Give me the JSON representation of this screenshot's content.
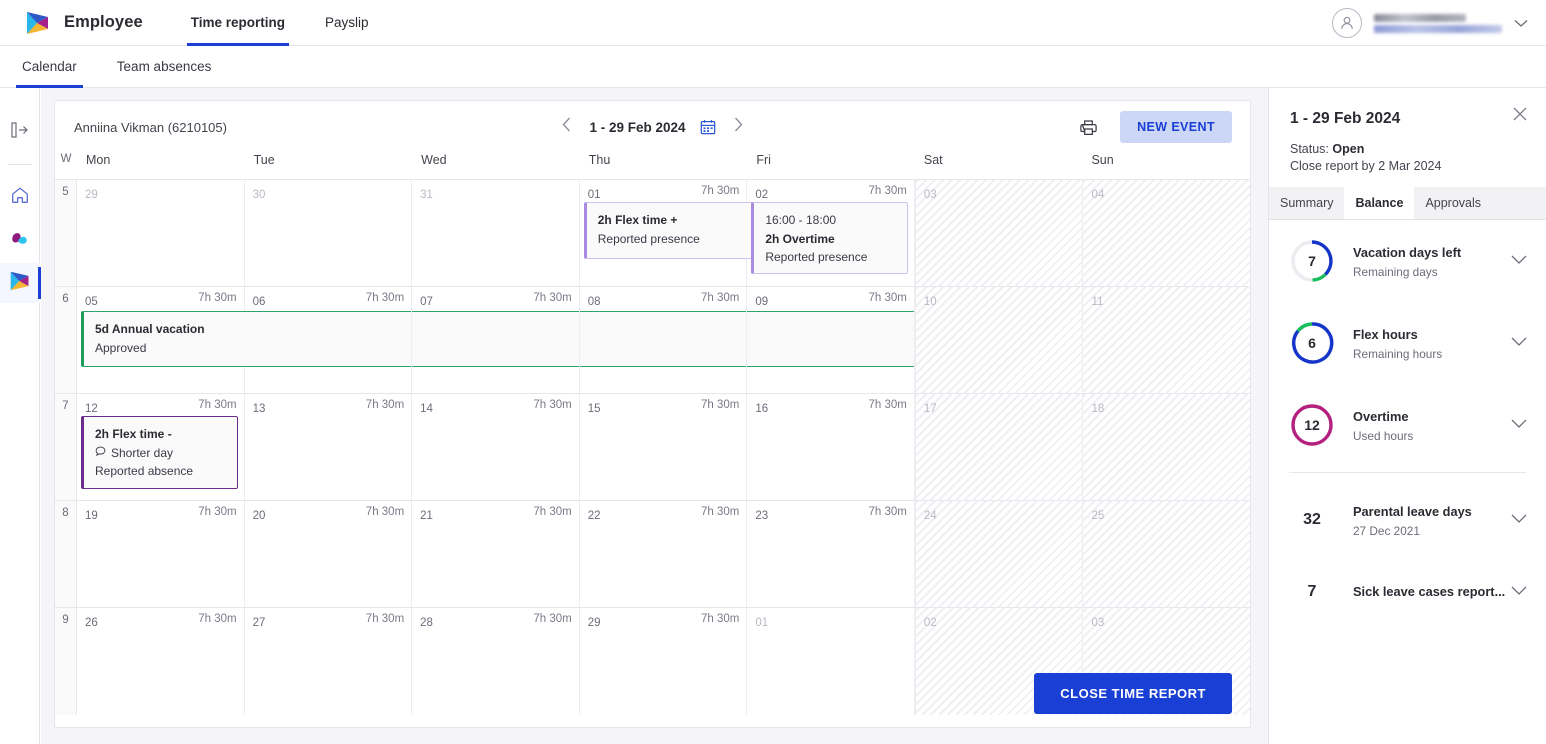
{
  "brand": {
    "name": "Employee",
    "logo_icon": "play-logo-icon"
  },
  "topnav": [
    {
      "label": "Time reporting",
      "active": true
    },
    {
      "label": "Payslip",
      "active": false
    }
  ],
  "subnav": [
    {
      "label": "Calendar",
      "active": true
    },
    {
      "label": "Team absences",
      "active": false
    }
  ],
  "user": {
    "avatar_icon": "person-avatar-icon",
    "caret_icon": "chevron-down-icon"
  },
  "rail": [
    {
      "icon": "panel-expand-icon",
      "active": false
    },
    {
      "icon": "home-icon",
      "active": false
    },
    {
      "icon": "cloud-leaf-icon",
      "active": false
    },
    {
      "icon": "play-logo-icon",
      "active": true
    }
  ],
  "calendar": {
    "employee": "Anniina Vikman (6210105)",
    "period": "1 - 29 Feb 2024",
    "prev_icon": "chevron-left-icon",
    "next_icon": "chevron-right-icon",
    "datepicker_icon": "calendar-icon",
    "print_icon": "printer-icon",
    "new_event_label": "NEW EVENT",
    "close_report_label": "CLOSE TIME REPORT",
    "week_col_header": "W",
    "day_headers": [
      "Mon",
      "Tue",
      "Wed",
      "Thu",
      "Fri",
      "Sat",
      "Sun"
    ],
    "default_hours": "7h 30m",
    "weeks": [
      {
        "week": "5",
        "days": [
          {
            "num": "29",
            "hours": "",
            "muted": true
          },
          {
            "num": "30",
            "hours": "",
            "muted": true
          },
          {
            "num": "31",
            "hours": "",
            "muted": true
          },
          {
            "num": "01",
            "hours": "7h 30m",
            "muted": false
          },
          {
            "num": "02",
            "hours": "7h 30m",
            "muted": false
          },
          {
            "num": "03",
            "hours": "",
            "muted": true,
            "weekend": true
          },
          {
            "num": "04",
            "hours": "",
            "muted": true,
            "weekend": true
          }
        ]
      },
      {
        "week": "6",
        "days": [
          {
            "num": "05",
            "hours": "7h 30m",
            "muted": false
          },
          {
            "num": "06",
            "hours": "7h 30m",
            "muted": false
          },
          {
            "num": "07",
            "hours": "7h 30m",
            "muted": false
          },
          {
            "num": "08",
            "hours": "7h 30m",
            "muted": false
          },
          {
            "num": "09",
            "hours": "7h 30m",
            "muted": false
          },
          {
            "num": "10",
            "hours": "",
            "muted": true,
            "weekend": true
          },
          {
            "num": "11",
            "hours": "",
            "muted": true,
            "weekend": true
          }
        ]
      },
      {
        "week": "7",
        "days": [
          {
            "num": "12",
            "hours": "7h 30m",
            "muted": false
          },
          {
            "num": "13",
            "hours": "7h 30m",
            "muted": false
          },
          {
            "num": "14",
            "hours": "7h 30m",
            "muted": false
          },
          {
            "num": "15",
            "hours": "7h 30m",
            "muted": false
          },
          {
            "num": "16",
            "hours": "7h 30m",
            "muted": false
          },
          {
            "num": "17",
            "hours": "",
            "muted": true,
            "weekend": true
          },
          {
            "num": "18",
            "hours": "",
            "muted": true,
            "weekend": true
          }
        ]
      },
      {
        "week": "8",
        "days": [
          {
            "num": "19",
            "hours": "7h 30m",
            "muted": false
          },
          {
            "num": "20",
            "hours": "7h 30m",
            "muted": false
          },
          {
            "num": "21",
            "hours": "7h 30m",
            "muted": false
          },
          {
            "num": "22",
            "hours": "7h 30m",
            "muted": false
          },
          {
            "num": "23",
            "hours": "7h 30m",
            "muted": false
          },
          {
            "num": "24",
            "hours": "",
            "muted": true,
            "weekend": true
          },
          {
            "num": "25",
            "hours": "",
            "muted": true,
            "weekend": true
          }
        ]
      },
      {
        "week": "9",
        "days": [
          {
            "num": "26",
            "hours": "7h 30m",
            "muted": false
          },
          {
            "num": "27",
            "hours": "7h 30m",
            "muted": false
          },
          {
            "num": "28",
            "hours": "7h 30m",
            "muted": false
          },
          {
            "num": "29",
            "hours": "7h 30m",
            "muted": false
          },
          {
            "num": "01",
            "hours": "",
            "muted": true
          },
          {
            "num": "02",
            "hours": "",
            "muted": true,
            "weekend": true
          },
          {
            "num": "03",
            "hours": "",
            "muted": true,
            "weekend": true
          }
        ]
      }
    ],
    "events": {
      "flex_plus": {
        "title": "2h Flex time +",
        "status": "Reported presence"
      },
      "overtime": {
        "time": "16:00 - 18:00",
        "title": "2h Overtime",
        "status": "Reported presence"
      },
      "vacation": {
        "title": "5d Annual vacation",
        "status": "Approved"
      },
      "flex_minus": {
        "title": "2h Flex time -",
        "note": "Shorter day",
        "note_icon": "comment-icon",
        "status": "Reported absence"
      }
    }
  },
  "panel": {
    "title": "1 - 29 Feb 2024",
    "close_icon": "close-icon",
    "status_label": "Status:",
    "status_value": "Open",
    "due": "Close report by 2 Mar 2024",
    "tabs": [
      {
        "label": "Summary",
        "active": false
      },
      {
        "label": "Balance",
        "active": true
      },
      {
        "label": "Approvals",
        "active": false
      }
    ],
    "balances": [
      {
        "value": "7",
        "title": "Vacation days left",
        "sub": "Remaining days",
        "ring": true,
        "chevron_icon": "chevron-down-icon"
      },
      {
        "value": "6",
        "title": "Flex hours",
        "sub": "Remaining hours",
        "ring": true,
        "chevron_icon": "chevron-down-icon"
      },
      {
        "value": "12",
        "title": "Overtime",
        "sub": "Used hours",
        "ring": true,
        "chevron_icon": "chevron-down-icon"
      }
    ],
    "balances_plain": [
      {
        "value": "32",
        "title": "Parental leave days",
        "sub": "27 Dec 2021",
        "chevron_icon": "chevron-down-icon"
      },
      {
        "value": "7",
        "title": "Sick leave cases report...",
        "sub": "",
        "chevron_icon": "chevron-down-icon"
      }
    ]
  },
  "colors": {
    "accent_blue": "#1a3fd4",
    "event_purple": "#a98ce0",
    "event_purple_dark": "#6b2d8c",
    "event_green": "#1f9d5c",
    "ring_blue": "#1534c9",
    "ring_green": "#18bd5c",
    "ring_magenta": "#b3217e",
    "ring_track": "#ebebf0"
  }
}
